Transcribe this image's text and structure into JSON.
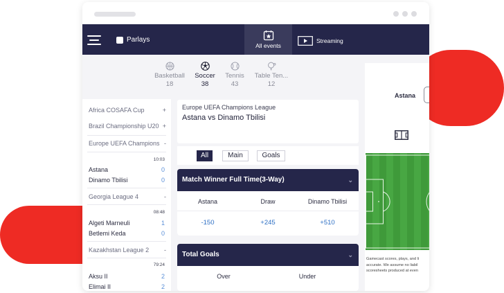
{
  "navbar": {
    "parlays_label": "Parlays",
    "tab_all_events": "All events",
    "tab_streaming": "Streaming"
  },
  "sports": [
    {
      "name": "Basketball",
      "count": "18",
      "icon": "basketball-icon"
    },
    {
      "name": "Soccer",
      "count": "38",
      "icon": "soccer-ball-icon"
    },
    {
      "name": "Tennis",
      "count": "43",
      "icon": "tennis-ball-icon"
    },
    {
      "name": "Table Ten...",
      "count": "12",
      "icon": "table-tennis-icon"
    }
  ],
  "sidebar": {
    "leagues": [
      {
        "name": "Africa COSAFA Cup",
        "toggle": "+"
      },
      {
        "name": "Brazil Championship U20",
        "toggle": "+"
      },
      {
        "name": "Europe UEFA Champions",
        "toggle": "-"
      },
      {
        "name": "Georgia League 4",
        "toggle": "-"
      },
      {
        "name": "Kazakhstan League 2",
        "toggle": "-"
      }
    ],
    "matches": [
      {
        "time": "10:03",
        "home": "Astana",
        "home_score": "0",
        "away": "Dinamo Tbilisi",
        "away_score": "0"
      },
      {
        "time": "08:48",
        "home": "Algeti Marneuli",
        "home_score": "1",
        "away": "Betlemi Keda",
        "away_score": "0"
      },
      {
        "time": "79:24",
        "home": "Aksu II",
        "home_score": "2",
        "away": "Elimai II",
        "away_score": "2"
      }
    ]
  },
  "match": {
    "league": "Europe UEFA Champions League",
    "title": "Astana vs Dinamo Tbilisi"
  },
  "filters": {
    "all": "All",
    "main": "Main",
    "goals": "Goals"
  },
  "markets": {
    "match_winner": {
      "title": "Match Winner Full Time(3-Way)",
      "col1": "Astana",
      "col2": "Draw",
      "col3": "Dinamo Tbilisi",
      "odd1": "-150",
      "odd2": "+245",
      "odd3": "+510"
    },
    "total_goals": {
      "title": "Total Goals",
      "col1": "Over",
      "col2": "Under"
    }
  },
  "gamecast": {
    "team": "Astana",
    "note_line1": "Gamecast scores, plays, and li",
    "note_line2": "accurate. We assume no liabil",
    "note_line3": "scoresheets produced at even"
  },
  "colors": {
    "navy": "#25264a",
    "accent_red": "#ee2b24",
    "odds_blue": "#2d6fc4",
    "pitch_green": "#48a743"
  }
}
